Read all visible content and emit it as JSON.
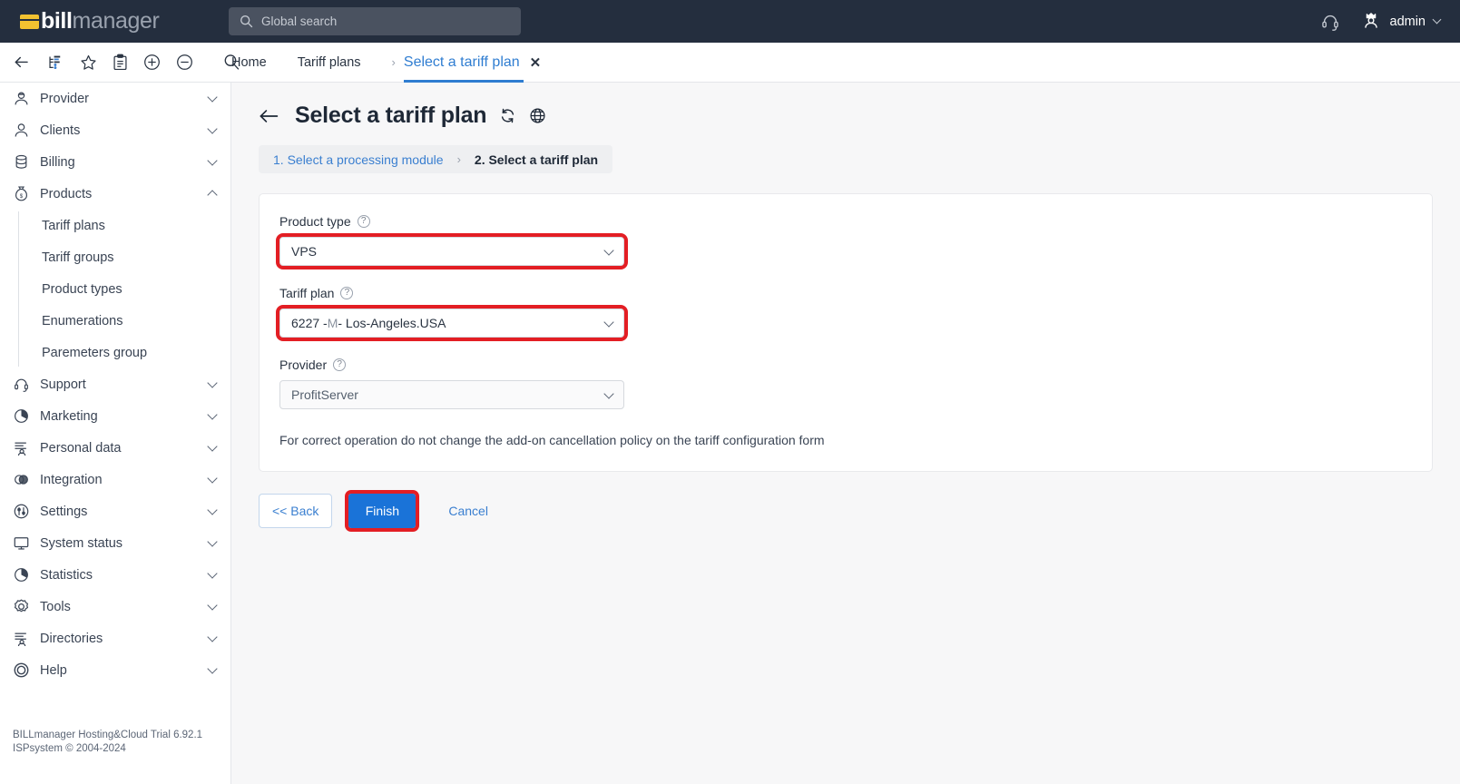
{
  "header": {
    "logo_bill": "bill",
    "logo_manager": "manager",
    "search_placeholder": "Global search",
    "support_icon": "headset-icon",
    "avatar_icon": "crown-avatar-icon",
    "admin_label": "admin"
  },
  "toolbar": {
    "icons": [
      "back-arrow-icon",
      "sitemap-icon",
      "star-icon",
      "clipboard-icon",
      "plus-circle-icon",
      "minus-circle-icon",
      "search-icon"
    ],
    "tabs": [
      {
        "label": "Home",
        "active": false
      },
      {
        "label": "Tariff plans",
        "active": false
      },
      {
        "label": "Select a tariff plan",
        "active": true
      }
    ],
    "separator": "›",
    "close_glyph": "✕"
  },
  "sidebar": {
    "items": [
      {
        "label": "Provider",
        "icon": "provider-icon",
        "expanded": false
      },
      {
        "label": "Clients",
        "icon": "clients-icon",
        "expanded": false
      },
      {
        "label": "Billing",
        "icon": "billing-icon",
        "expanded": false
      },
      {
        "label": "Products",
        "icon": "products-icon",
        "expanded": true
      }
    ],
    "sub_items": [
      {
        "label": "Tariff plans"
      },
      {
        "label": "Tariff groups"
      },
      {
        "label": "Product types"
      },
      {
        "label": "Enumerations"
      },
      {
        "label": "Paremeters group"
      }
    ],
    "items_after": [
      {
        "label": "Support",
        "icon": "support-icon"
      },
      {
        "label": "Marketing",
        "icon": "marketing-icon"
      },
      {
        "label": "Personal data",
        "icon": "personal-data-icon"
      },
      {
        "label": "Integration",
        "icon": "integration-icon"
      },
      {
        "label": "Settings",
        "icon": "settings-icon"
      },
      {
        "label": "System status",
        "icon": "system-status-icon"
      },
      {
        "label": "Statistics",
        "icon": "statistics-icon"
      },
      {
        "label": "Tools",
        "icon": "tools-icon"
      },
      {
        "label": "Directories",
        "icon": "directories-icon"
      },
      {
        "label": "Help",
        "icon": "help-icon"
      }
    ],
    "footer_line1": "BILLmanager Hosting&Cloud Trial 6.92.1",
    "footer_line2": "ISPsystem © 2004-2024"
  },
  "page": {
    "title": "Select a tariff plan",
    "back_icon": "back-arrow-icon",
    "refresh_icon": "refresh-icon",
    "globe_icon": "globe-icon",
    "step1": "1. Select a processing module",
    "step_sep": "›",
    "step2": "2. Select a tariff plan"
  },
  "form": {
    "product_type": {
      "label": "Product type",
      "value": "VPS",
      "help": "?",
      "highlighted": true
    },
    "tariff_plan": {
      "label": "Tariff plan",
      "value_prefix": "6227 - ",
      "value_dim": "M",
      "value_suffix": " - Los-Angeles.USA",
      "help": "?",
      "highlighted": true
    },
    "provider": {
      "label": "Provider",
      "value": "ProfitServer",
      "help": "?",
      "highlighted": false
    },
    "note": "For correct operation do not change the add-on cancellation policy on the tariff configuration form"
  },
  "actions": {
    "back": "<< Back",
    "finish": "Finish",
    "cancel": "Cancel"
  },
  "colors": {
    "header_bg": "#242E3E",
    "accent_blue": "#3A7FD0",
    "button_blue": "#1A73D8",
    "highlight_red": "#E31E24",
    "logo_yellow": "#F2C230",
    "page_bg": "#F7F7F8"
  }
}
